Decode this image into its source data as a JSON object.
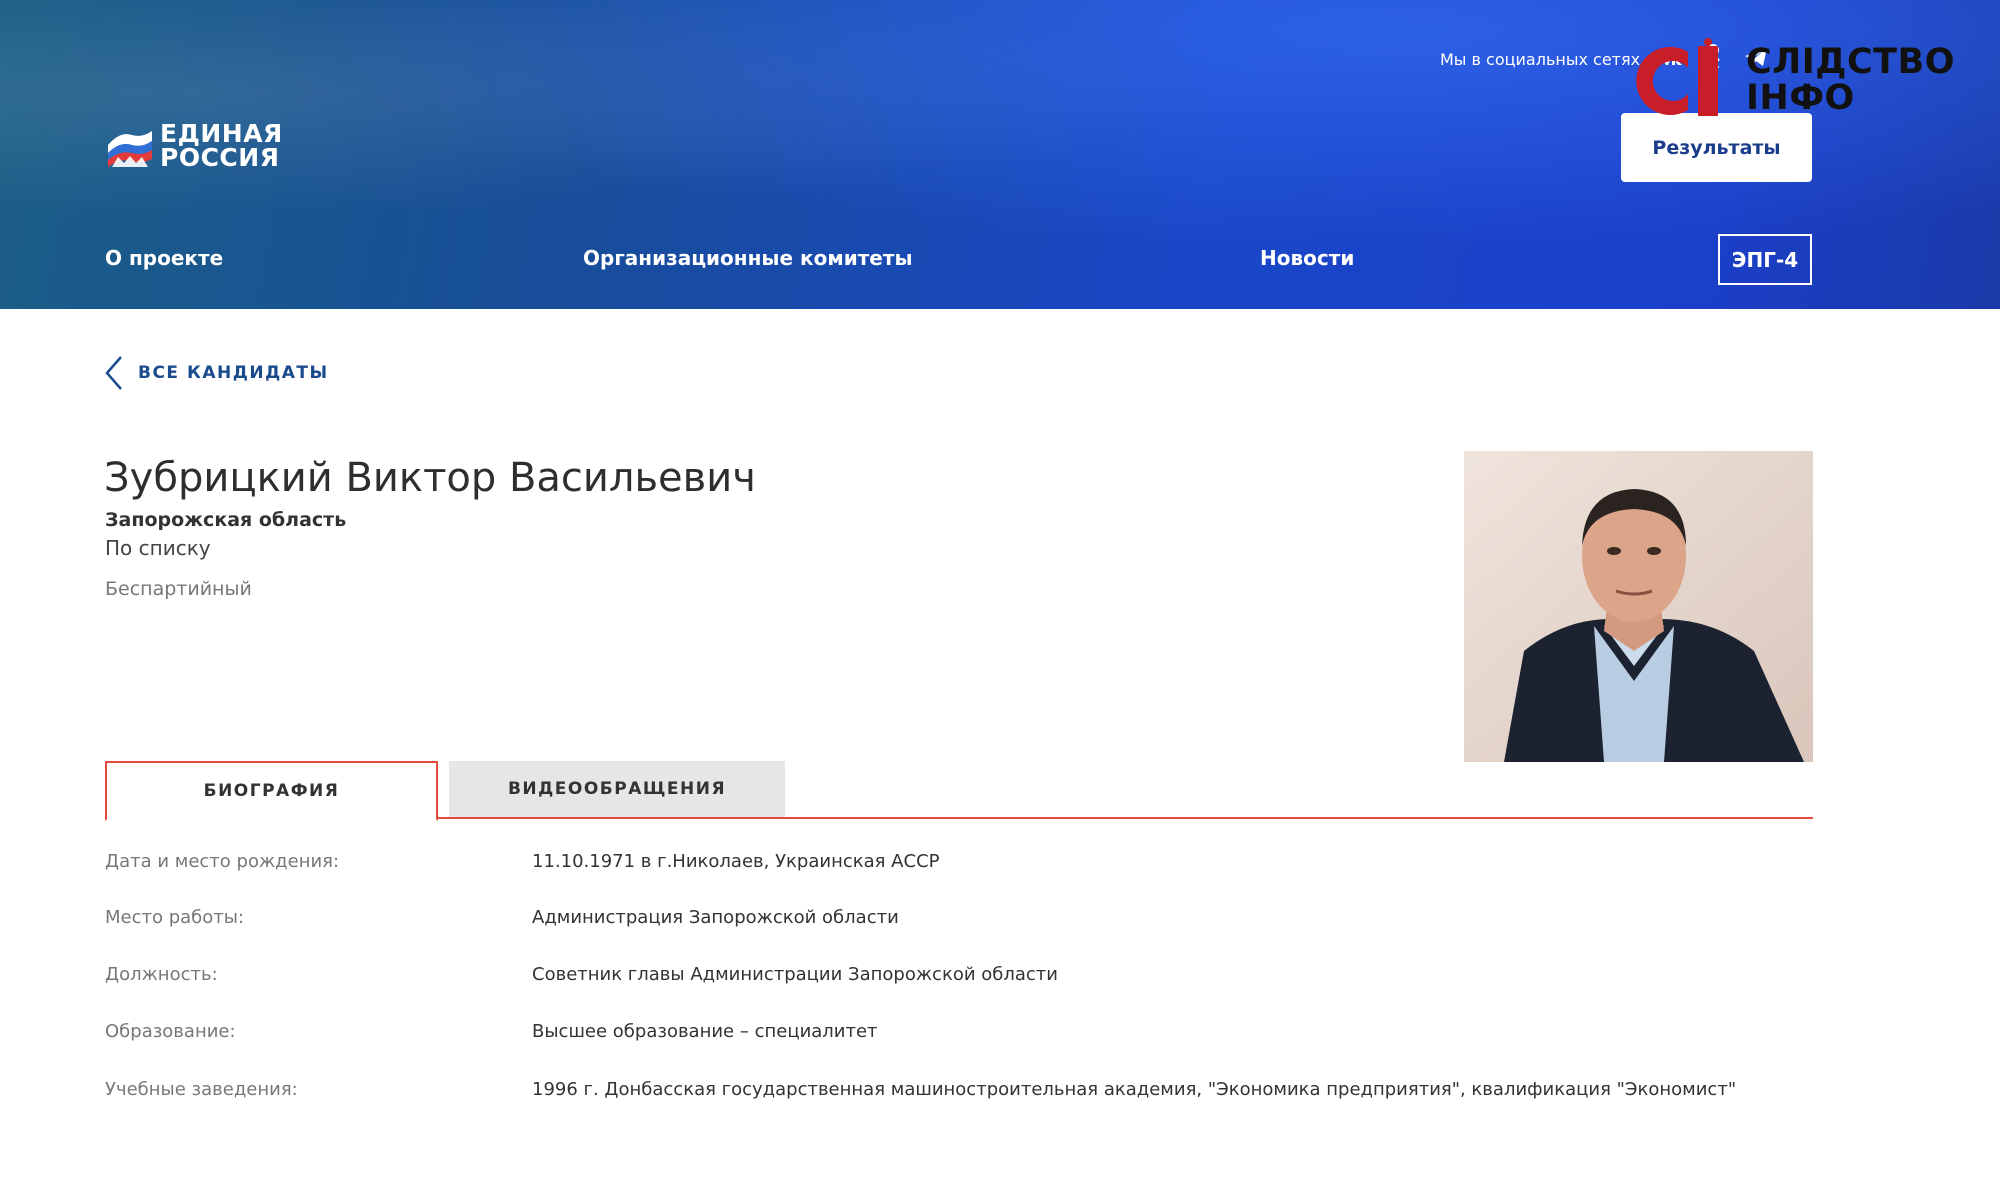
{
  "header": {
    "logo_line1": "ЕДИНАЯ",
    "logo_line2": "РОССИЯ",
    "social_label": "Мы в социальных сетях",
    "social_icons": [
      "vk-icon",
      "ok-icon",
      "telegram-icon"
    ],
    "results_button": "Результаты",
    "watermark_line1": "СЛІДСТВО",
    "watermark_line2": "ІНФО",
    "nav": [
      "О проекте",
      "Организационные комитеты",
      "Новости"
    ],
    "epg_button": "ЭПГ-4"
  },
  "back_link": "ВСЕ КАНДИДАТЫ",
  "candidate": {
    "name": "Зубрицкий Виктор Васильевич",
    "region": "Запорожская область",
    "list": "По списку",
    "party": "Беспартийный"
  },
  "tabs": [
    "БИОГРАФИЯ",
    "ВИДЕООБРАЩЕНИЯ"
  ],
  "bio": [
    {
      "label": "Дата и место рождения:",
      "value": "11.10.1971 в г.Николаев, Украинская АССР"
    },
    {
      "label": "Место работы:",
      "value": "Администрация Запорожской области"
    },
    {
      "label": "Должность:",
      "value": "Советник главы Администрации Запорожской области"
    },
    {
      "label": "Образование:",
      "value": "Высшее образование – специалитет"
    },
    {
      "label": "Учебные заведения:",
      "value": "1996 г. Донбасская государственная машиностроительная академия, \"Экономика предприятия\", квалификация \"Экономист\""
    }
  ],
  "colors": {
    "accent_red": "#e24a3a",
    "link_blue": "#1a4b8c",
    "header_blue": "#1a47c8"
  }
}
